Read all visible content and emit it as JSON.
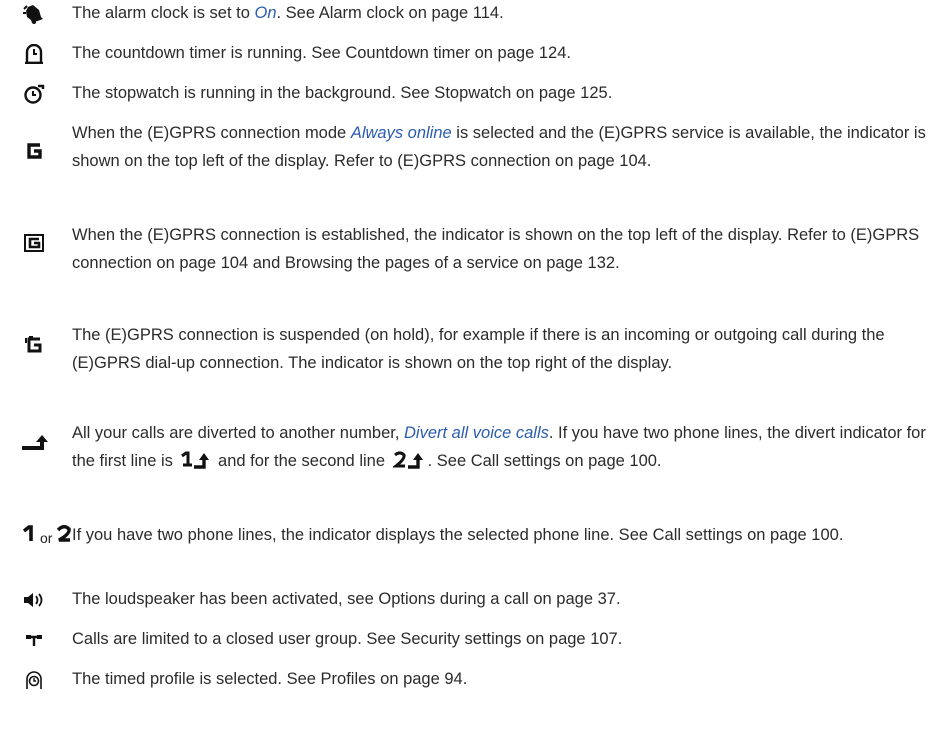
{
  "entries": [
    {
      "id": "alarm",
      "icon": "alarm-bell-icon",
      "pre": "The alarm clock is set to ",
      "link": "On",
      "post": ". See Alarm clock on page 114."
    },
    {
      "id": "countdown",
      "icon": "countdown-timer-icon",
      "text": "The countdown timer is running. See Countdown timer on page 124."
    },
    {
      "id": "stopwatch",
      "icon": "stopwatch-icon",
      "text": "The stopwatch is running in the background. See Stopwatch on page 125."
    },
    {
      "id": "gprs-online",
      "icon": "gprs-g-icon",
      "pre": "When the (E)GPRS connection mode ",
      "link": "Always online",
      "post": " is selected and the (E)GPRS service is available, the indicator is shown on the top left of the display. Refer to (E)GPRS connection on page 104."
    },
    {
      "id": "gprs-established",
      "icon": "gprs-connected-icon",
      "text": "When the (E)GPRS connection is established, the indicator is shown on the top left of the display. Refer to (E)GPRS connection on page 104 and Browsing the pages of a service on page 132."
    },
    {
      "id": "gprs-suspended",
      "icon": "gprs-suspended-icon",
      "text": "The (E)GPRS connection is suspended (on hold), for example if there is an incoming or outgoing call during the (E)GPRS dial-up connection. The indicator is shown on the top right of the display."
    },
    {
      "id": "divert",
      "icon": "divert-arrow-icon",
      "pre": "All your calls are diverted to another number, ",
      "link": "Divert all voice calls",
      "mid1": ". If you have two phone lines, the divert indicator for the first line is ",
      "mid2": " and for the second line ",
      "post": ". See Call settings on page 100."
    },
    {
      "id": "phone-line",
      "icon": "line-1-icon",
      "icon_or": "or",
      "icon2": "line-2-icon",
      "text": "If you have two phone lines, the indicator displays the selected phone line. See Call settings on page 100."
    },
    {
      "id": "loudspeaker",
      "icon": "loudspeaker-icon",
      "text": "The loudspeaker has been activated, see Options during a call on page 37."
    },
    {
      "id": "closed-group",
      "icon": "closed-user-group-icon",
      "text": "Calls are limited to a closed user group. See Security settings on page 107."
    },
    {
      "id": "timed-profile",
      "icon": "timed-profile-icon",
      "text": "The timed profile is selected. See Profiles on page 94."
    }
  ],
  "colors": {
    "text": "#2b2b2b",
    "link": "#2a5db0",
    "icon": "#111111"
  }
}
